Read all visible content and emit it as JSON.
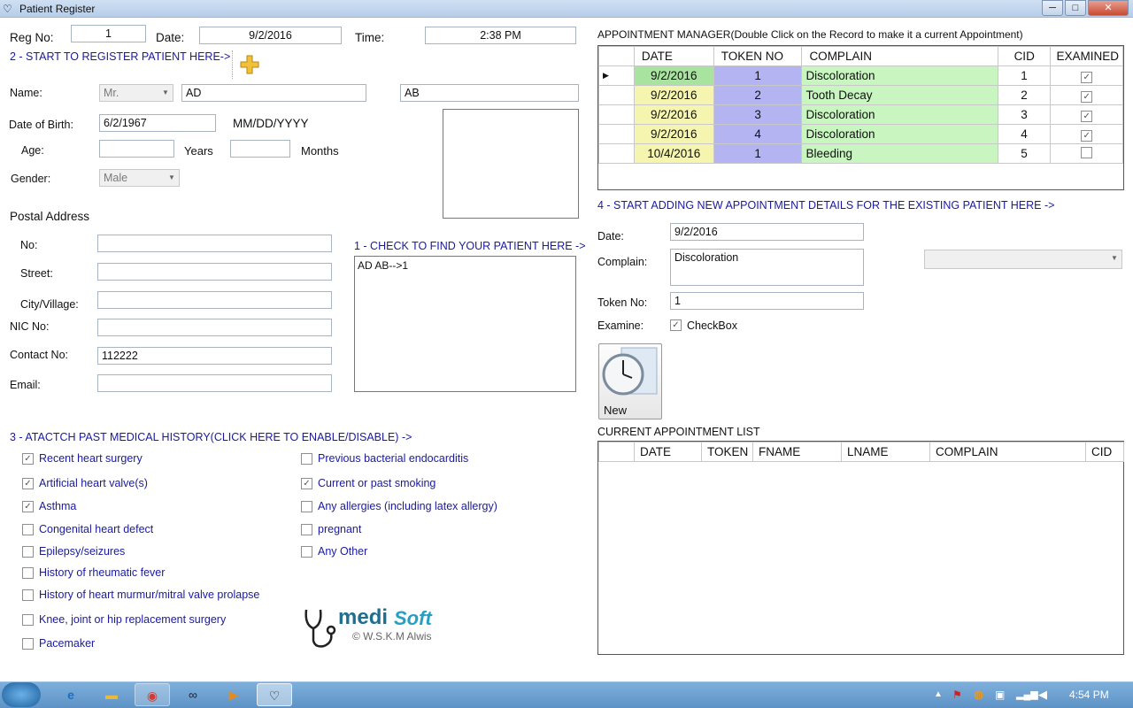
{
  "window": {
    "title": "Patient Register",
    "min": "─",
    "max": "□",
    "close": "✕"
  },
  "reg": {
    "regno_label": "Reg No:",
    "regno": "1",
    "date_label": "Date:",
    "date": "9/2/2016",
    "time_label": "Time:",
    "time": "2:38 PM"
  },
  "sections": {
    "s2": "2 - START TO REGISTER PATIENT HERE->",
    "s1": "1 - CHECK TO FIND YOUR PATIENT HERE ->",
    "s3": "3 - ATACTCH PAST MEDICAL HISTORY(CLICK HERE TO ENABLE/DISABLE) ->",
    "s4": "4 - START ADDING NEW APPOINTMENT DETAILS FOR THE EXISTING PATIENT HERE ->",
    "appt_mgr": "APPOINTMENT MANAGER(Double Click on the Record to make it a current Appointment)",
    "current_list": "CURRENT APPOINTMENT LIST"
  },
  "patient": {
    "name_label": "Name:",
    "title": "Mr.",
    "first": "AD",
    "last": "AB",
    "dob_label": "Date of Birth:",
    "dob": "6/2/1967",
    "dob_format": "MM/DD/YYYY",
    "age_label": "Age:",
    "years_label": "Years",
    "months_label": "Months",
    "age_years": "",
    "age_months": "",
    "gender_label": "Gender:",
    "gender": "Male",
    "postal_label": "Postal Address",
    "no_label": "No:",
    "street_label": "Street:",
    "city_label": "City/Village:",
    "nic_label": "NIC No:",
    "contact_label": "Contact No:",
    "contact": "112222",
    "email_label": "Email:",
    "no": "",
    "street": "",
    "city": "",
    "nic": "",
    "email": ""
  },
  "search": {
    "result": "AD AB-->1"
  },
  "history": {
    "left": [
      {
        "label": "Recent heart surgery",
        "checked": true
      },
      {
        "label": "Artificial heart valve(s)",
        "checked": true
      },
      {
        "label": "Asthma",
        "checked": true
      },
      {
        "label": "Congenital heart defect",
        "checked": false
      },
      {
        "label": "Epilepsy/seizures",
        "checked": false
      },
      {
        "label": "History of rheumatic fever",
        "checked": false
      },
      {
        "label": "History of heart murmur/mitral valve prolapse",
        "checked": false
      },
      {
        "label": "Knee, joint or hip replacement surgery",
        "checked": false
      },
      {
        "label": "Pacemaker",
        "checked": false
      }
    ],
    "right": [
      {
        "label": "Previous bacterial endocarditis",
        "checked": false
      },
      {
        "label": "Current or past smoking",
        "checked": true
      },
      {
        "label": "Any allergies (including latex allergy)",
        "checked": false
      },
      {
        "label": "pregnant",
        "checked": false
      },
      {
        "label": "Any Other",
        "checked": false
      }
    ]
  },
  "appointments": {
    "headers": [
      "DATE",
      "TOKEN NO",
      "COMPLAIN",
      "CID",
      "EXAMINED"
    ],
    "rows": [
      {
        "date": "9/2/2016",
        "token": "1",
        "complain": "Discoloration",
        "cid": "1",
        "examined": true
      },
      {
        "date": "9/2/2016",
        "token": "2",
        "complain": "Tooth Decay",
        "cid": "2",
        "examined": true
      },
      {
        "date": "9/2/2016",
        "token": "3",
        "complain": "Discoloration",
        "cid": "3",
        "examined": true
      },
      {
        "date": "9/2/2016",
        "token": "4",
        "complain": "Discoloration",
        "cid": "4",
        "examined": true
      },
      {
        "date": "10/4/2016",
        "token": "1",
        "complain": "Bleeding",
        "cid": "5",
        "examined": false
      }
    ]
  },
  "new_appt": {
    "date_label": "Date:",
    "date": "9/2/2016",
    "complain_label": "Complain:",
    "complain": "Discoloration",
    "token_label": "Token No:",
    "token": "1",
    "examine_label": "Examine:",
    "examine_check": "CheckBox",
    "new_button": "New"
  },
  "current_list": {
    "headers": [
      "DATE",
      "TOKEN",
      "FNAME",
      "LNAME",
      "COMPLAIN",
      "CID"
    ]
  },
  "logo": {
    "medi": "medi",
    "soft": "Soft",
    "credit": "© W.S.K.M Alwis"
  },
  "taskbar": {
    "time": "4:54 PM"
  },
  "colors": {
    "date_cell": "#f5f5b0",
    "date_cell_sel": "#a8e4a0",
    "token_cell": "#b4b4f2",
    "complain_cell": "#c8f5c0",
    "section_blue": "#1a1aa0"
  }
}
